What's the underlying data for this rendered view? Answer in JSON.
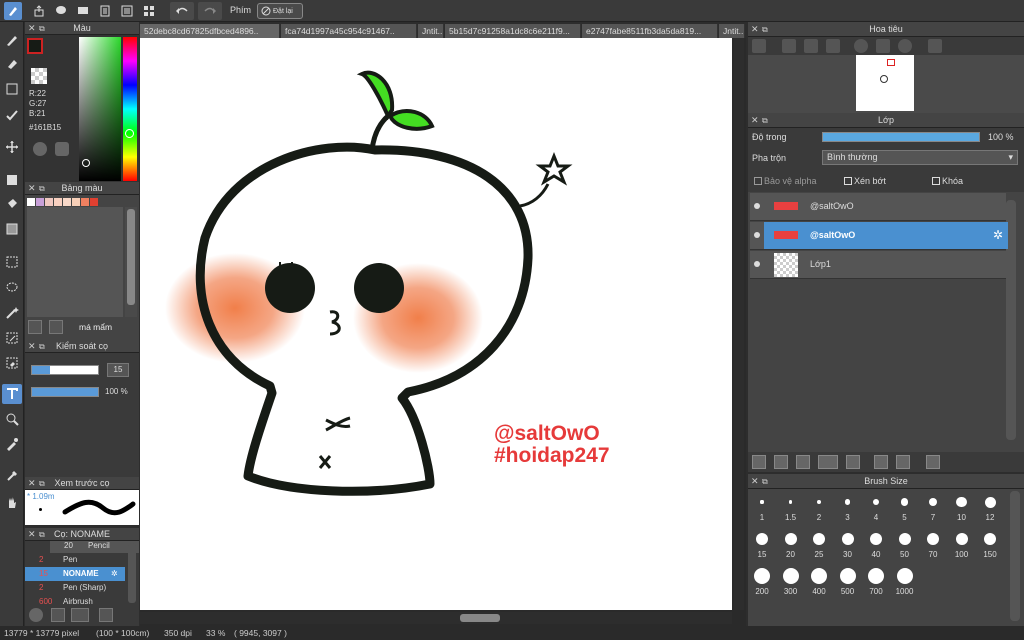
{
  "toolbar": {
    "key_label": "Phím",
    "reset_label": "Đặt lại"
  },
  "tabs": [
    "52debc8cd67825dfbced4896..",
    "fca74d1997a45c954c91467..",
    "Jntit..",
    "5b15d7c91258a1dc8c6e211f9...",
    "e2747fabe8511fb3da5da819...",
    "Jntit.."
  ],
  "color_panel": {
    "title": "Màu",
    "r": "R:22",
    "g": "G:27",
    "b": "B:21",
    "hex": "#161B15"
  },
  "palette_panel": {
    "title": "Bảng màu",
    "name": "má mẩm",
    "swatches": [
      "#ffffff",
      "#c8a0d8",
      "#f0c8c0",
      "#f8d0c0",
      "#f8d8c8",
      "#f8d0b8",
      "#f08060",
      "#e04030"
    ]
  },
  "brush_control": {
    "title": "Kiểm soát cọ",
    "size_value": "15",
    "opacity_value": "100 %"
  },
  "brush_preview": {
    "title": "Xem trước cọ",
    "size_label": "* 1.09m"
  },
  "brush_list": {
    "title": "Cọ: NONAME",
    "items": [
      {
        "size": "20",
        "name": "Pencil"
      },
      {
        "size": "2",
        "name": "Pen"
      },
      {
        "size": "15",
        "name": "NONAME"
      },
      {
        "size": "2",
        "name": "Pen (Sharp)"
      },
      {
        "size": "600",
        "name": "Airbrush"
      }
    ]
  },
  "navigator": {
    "title": "Hoa tiêu"
  },
  "layers": {
    "title": "Lớp",
    "opacity_label": "Độ trong",
    "opacity_value": "100 %",
    "blend_label": "Pha trộn",
    "blend_value": "Bình thường",
    "protect_alpha": "Bảo vệ alpha",
    "clipping": "Xén bớt",
    "lock": "Khóa",
    "items": [
      {
        "name": "@saltOwO"
      },
      {
        "name": "@saltOwO"
      },
      {
        "name": "Lớp1"
      }
    ]
  },
  "brush_size": {
    "title": "Brush Size",
    "sizes": [
      "1",
      "1.5",
      "2",
      "3",
      "4",
      "5",
      "7",
      "10",
      "12",
      "15",
      "20",
      "25",
      "30",
      "40",
      "50",
      "70",
      "100",
      "150",
      "200",
      "300",
      "400",
      "500",
      "700",
      "1000"
    ]
  },
  "canvas": {
    "watermark_line1": "@saltOwO",
    "watermark_line2": "#hoidap247"
  },
  "statusbar": {
    "size": "13779 * 13779 pixel",
    "cm": "(100 * 100cm)",
    "dpi": "350 dpi",
    "zoom": "33 %",
    "coords": "( 9945, 3097 )"
  },
  "colors": {
    "accent": "#4a8fd0",
    "selected_layer": "#4a90d0",
    "blush": "#f08050",
    "sprout": "#44dd22",
    "watermark": "#e63a3a"
  }
}
